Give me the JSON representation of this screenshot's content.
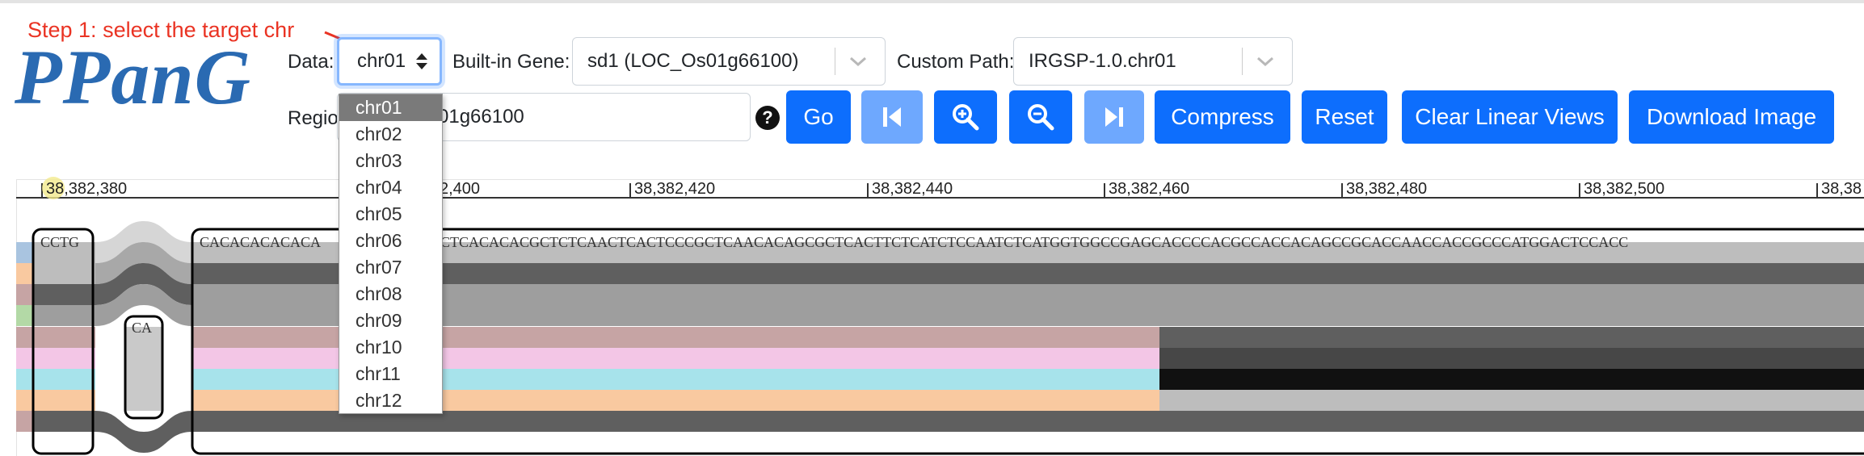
{
  "annotation": {
    "text": "Step 1: select the target chr",
    "color": "#ea3323"
  },
  "logo": {
    "text": "PPanG",
    "color": "#2a6ab2"
  },
  "controls": {
    "data_label": "Data:",
    "data_value": "chr01",
    "gene_label": "Built-in Gene:",
    "gene_value": "sd1 (LOC_Os01g66100)",
    "path_label": "Custom Path:",
    "path_value": "IRGSP-1.0.chr01",
    "region_label": "Regio",
    "region_value": "01g66100",
    "help_icon": "?"
  },
  "buttons": {
    "go": "Go",
    "first_icon": "skip-to-start-icon",
    "zoom_in_icon": "zoom-in-icon",
    "zoom_out_icon": "zoom-out-icon",
    "last_icon": "skip-to-end-icon",
    "compress": "Compress",
    "reset": "Reset",
    "clear": "Clear Linear Views",
    "download": "Download Image"
  },
  "dropdown": {
    "options": [
      "chr01",
      "chr02",
      "chr03",
      "chr04",
      "chr05",
      "chr06",
      "chr07",
      "chr08",
      "chr09",
      "chr10",
      "chr11",
      "chr12"
    ],
    "selected": "chr01"
  },
  "ruler": {
    "labels": [
      "38,382,380",
      "2,400",
      "38,382,420",
      "38,382,440",
      "38,382,460",
      "38,382,480",
      "38,382,500",
      "38,38"
    ]
  },
  "graph": {
    "nodes": [
      {
        "label": "CCTG"
      },
      {
        "label": "CA"
      },
      {
        "label": "CACACACACACA"
      },
      {
        "label": "CTCACACACGCTCTCAACTCACTCCCGCTCAACACAGCGCTCACTTCTCATCTCCAATCTCATGGTGGCCGAGCACCCCACGCCACCACAGCCGCACCAACCACCGCCCATGGACTCCACC"
      }
    ],
    "path_colors": [
      "#a9c4e0",
      "#f9c9a0",
      "#c6a4a4",
      "#b3d9a6",
      "#c6a4a4",
      "#f3c6e6",
      "#a7e3eb",
      "#f9c9a0",
      "#c6a4a4"
    ],
    "track_shades": [
      "#bdbdbd",
      "#5f5f5f",
      "#9e9e9e",
      "#474747",
      "#111111",
      "#bdbdbd"
    ]
  }
}
